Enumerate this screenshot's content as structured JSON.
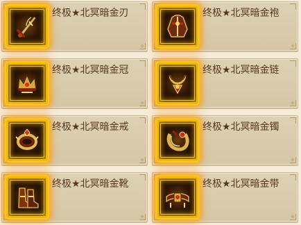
{
  "items": [
    {
      "name": "终极★北冥暗金刃",
      "icon": "blade-icon"
    },
    {
      "name": "终极★北冥暗金袍",
      "icon": "robe-icon"
    },
    {
      "name": "终极★北冥暗金冠",
      "icon": "crown-icon"
    },
    {
      "name": "终极★北冥暗金链",
      "icon": "necklace-icon"
    },
    {
      "name": "终极★北冥暗金戒",
      "icon": "ring-icon"
    },
    {
      "name": "终极★北冥暗金镯",
      "icon": "bracelet-icon"
    },
    {
      "name": "终极★北冥暗金靴",
      "icon": "boots-icon"
    },
    {
      "name": "终极★北冥暗金带",
      "icon": "belt-icon"
    }
  ],
  "colors": {
    "card_bg": "#d8cbab",
    "card_border": "#c9b791",
    "text": "#57361d",
    "glow": "#ffb000"
  }
}
